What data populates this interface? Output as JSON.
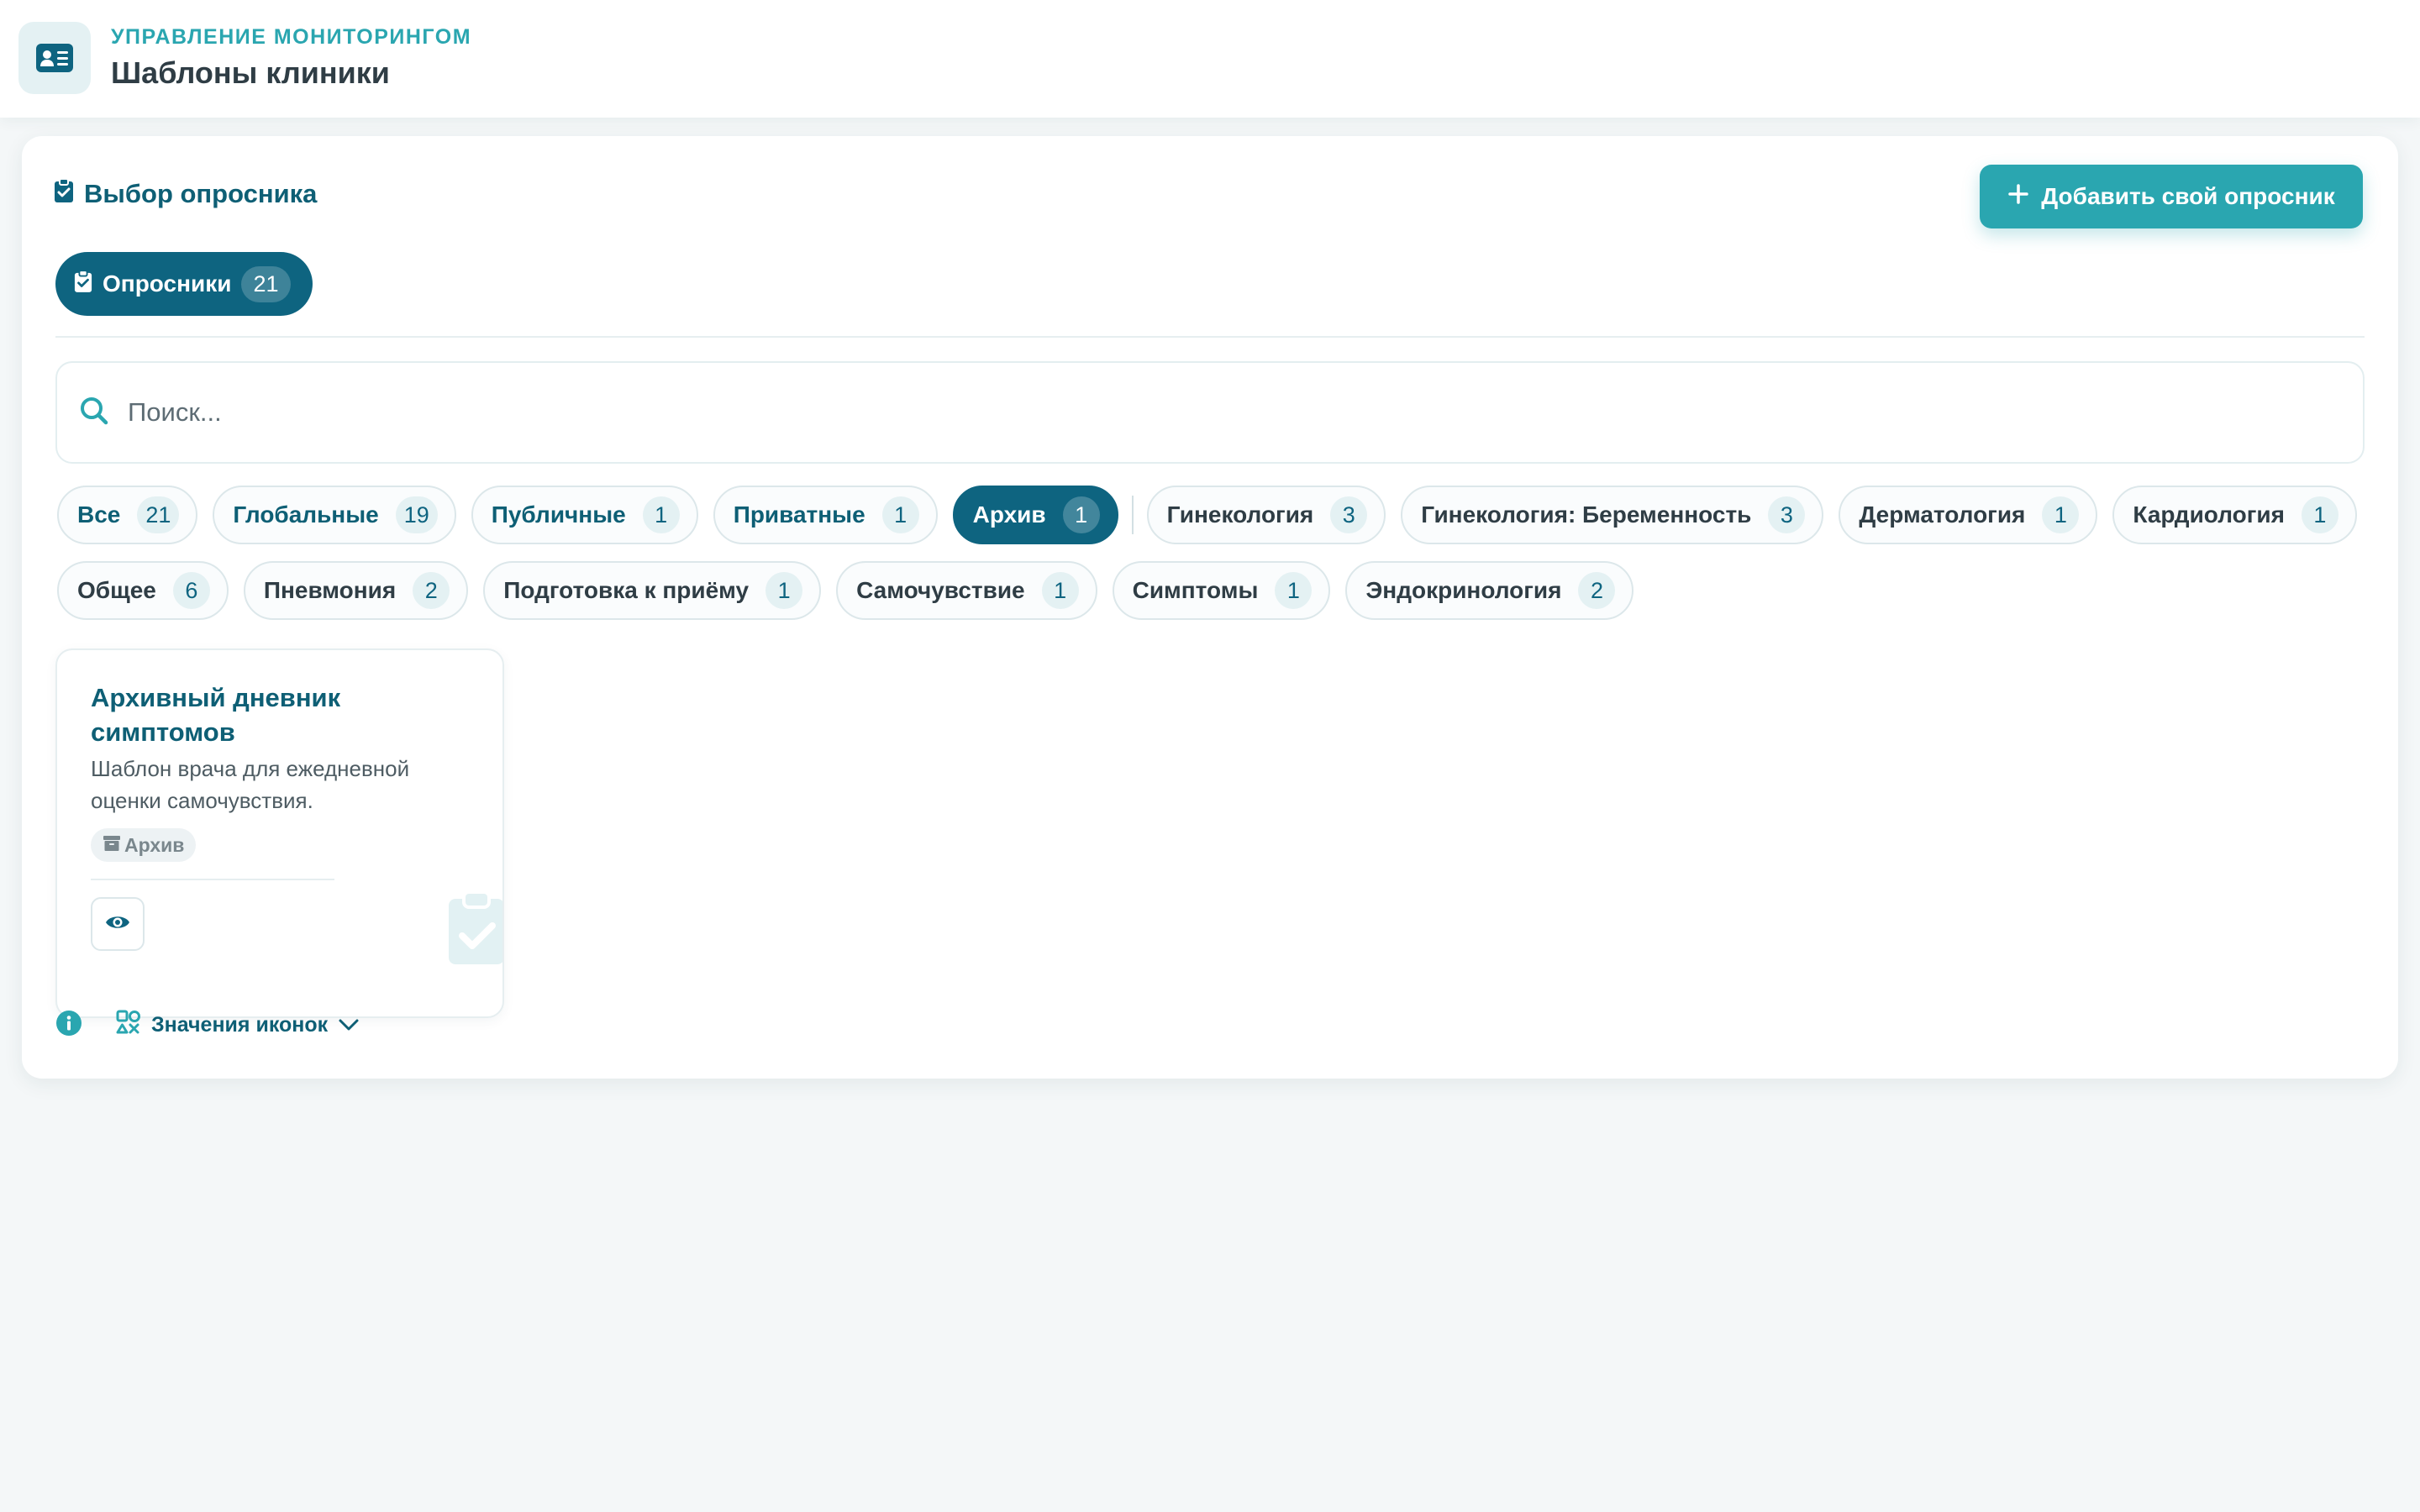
{
  "header": {
    "eyebrow": "УПРАВЛЕНИЕ МОНИТОРИНГОМ",
    "title": "Шаблоны клиники",
    "icon": "id-card-icon"
  },
  "section": {
    "title": "Выбор опросника",
    "add_button": "Добавить свой опросник"
  },
  "tab": {
    "label": "Опросники",
    "count": "21"
  },
  "search": {
    "placeholder": "Поиск...",
    "value": ""
  },
  "filters_row1": [
    {
      "label": "Все",
      "count": "21"
    },
    {
      "label": "Глобальные",
      "count": "19"
    },
    {
      "label": "Публичные",
      "count": "1"
    },
    {
      "label": "Приватные",
      "count": "1"
    },
    {
      "label": "Архив",
      "count": "1"
    },
    {
      "label": "Гинекология",
      "count": "3"
    },
    {
      "label": "Гинекология: Беременность",
      "count": "3"
    },
    {
      "label": "Дерматология",
      "count": "1"
    },
    {
      "label": "Кардиология",
      "count": "1"
    }
  ],
  "filters_row2": [
    {
      "label": "Общее",
      "count": "6"
    },
    {
      "label": "Пневмония",
      "count": "2"
    },
    {
      "label": "Подготовка к приёму",
      "count": "1"
    },
    {
      "label": "Самочувствие",
      "count": "1"
    },
    {
      "label": "Симптомы",
      "count": "1"
    },
    {
      "label": "Эндокринология",
      "count": "2"
    }
  ],
  "active_filter": "Архив",
  "template_card": {
    "title": "Архивный дневник симптомов",
    "description": "Шаблон врача для ежедневной оценки самочувствия.",
    "tag": "Архив"
  },
  "legend": {
    "label": "Значения иконок"
  },
  "colors": {
    "primary_dark": "#0e6480",
    "accent": "#2aa6b0",
    "chip_count_bg": "#e4f1f3",
    "background": "#f4f7f8"
  }
}
